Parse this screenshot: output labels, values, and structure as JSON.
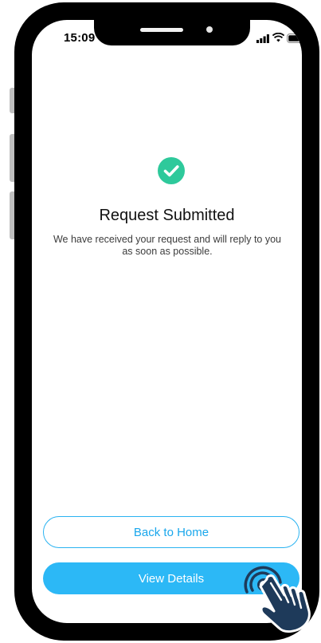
{
  "status_bar": {
    "time": "15:09",
    "icons": [
      "signal-icon",
      "wifi-icon",
      "battery-icon"
    ]
  },
  "confirmation": {
    "icon": "check-circle-icon",
    "title": "Request Submitted",
    "message": "We have received your request and will reply to you as soon as possible."
  },
  "actions": {
    "back_label": "Back to Home",
    "details_label": "View Details"
  },
  "overlay": {
    "icon": "tap-hand-icon"
  },
  "colors": {
    "accent": "#2cb8f6",
    "success": "#2ec99b",
    "text": "#111111",
    "subtext": "#3c3c3c",
    "hand_fill": "#1e3a5a"
  }
}
